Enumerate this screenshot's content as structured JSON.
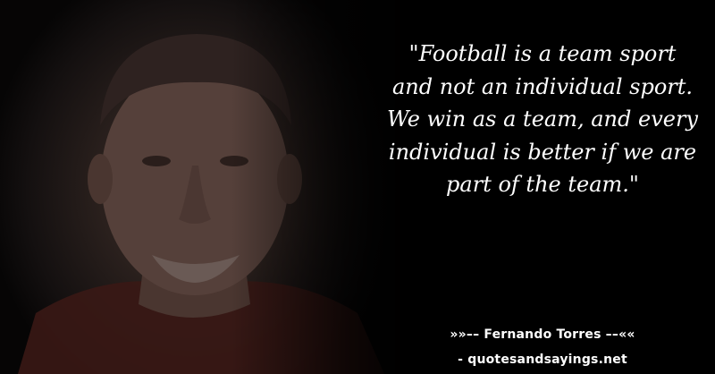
{
  "quote": {
    "text": "\"Football is a team sport and not an individual sport. We win as a team, and every individual is better if we are part of the team.\""
  },
  "author": {
    "line": "»»–– Fernando Torres ––««"
  },
  "source": {
    "line": "- quotesandsayings.net"
  },
  "colors": {
    "background": "#000000",
    "text": "#ffffff"
  }
}
